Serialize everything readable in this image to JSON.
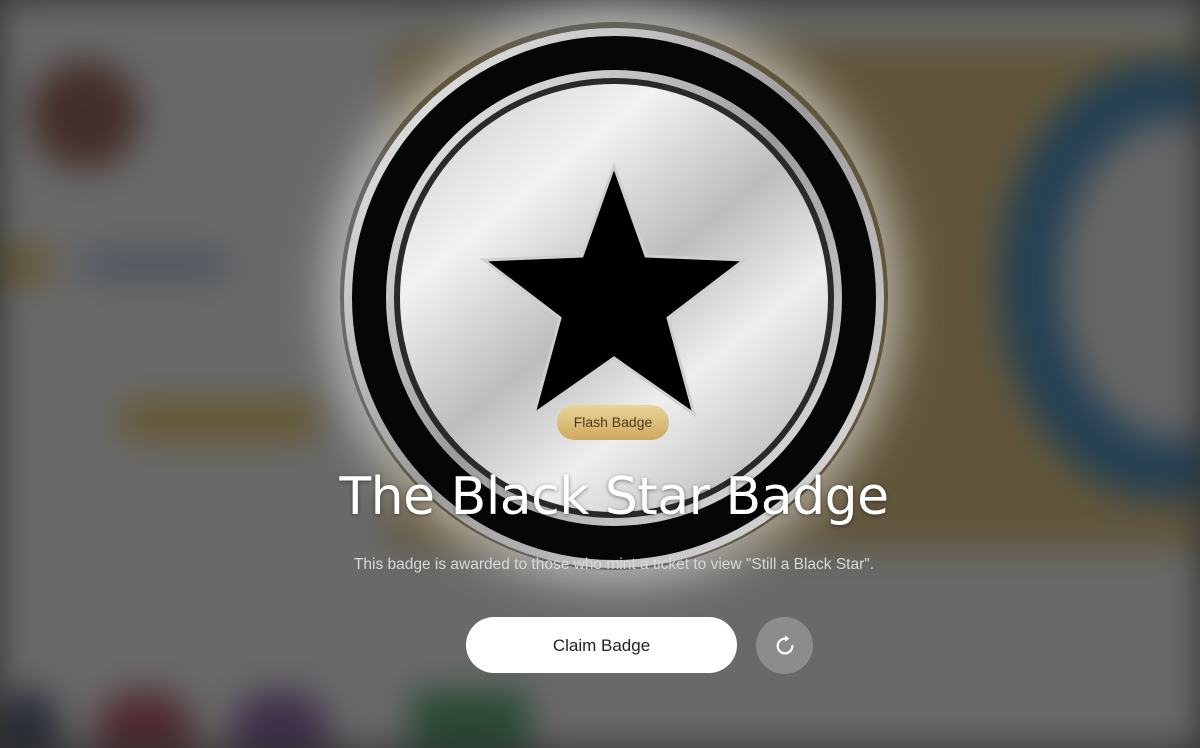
{
  "background": {
    "description_colors": {
      "page": "#e8e8e8",
      "gold_panel": "#cfae62",
      "blue_ring": "#1e6fa8",
      "dim_overlay": "rgba(40,40,40,0.66)"
    }
  },
  "badge": {
    "icon": "black-star-icon",
    "colors": {
      "outer_ring": "#050505",
      "silver": "#d9d9d9",
      "star": "#000000"
    },
    "flash_label": "Flash Badge",
    "title": "The Black Star Badge",
    "description": "This badge is awarded to those who mint a ticket to view \"Still a Black Star\"."
  },
  "actions": {
    "claim_label": "Claim Badge",
    "refresh_icon": "refresh-icon"
  }
}
